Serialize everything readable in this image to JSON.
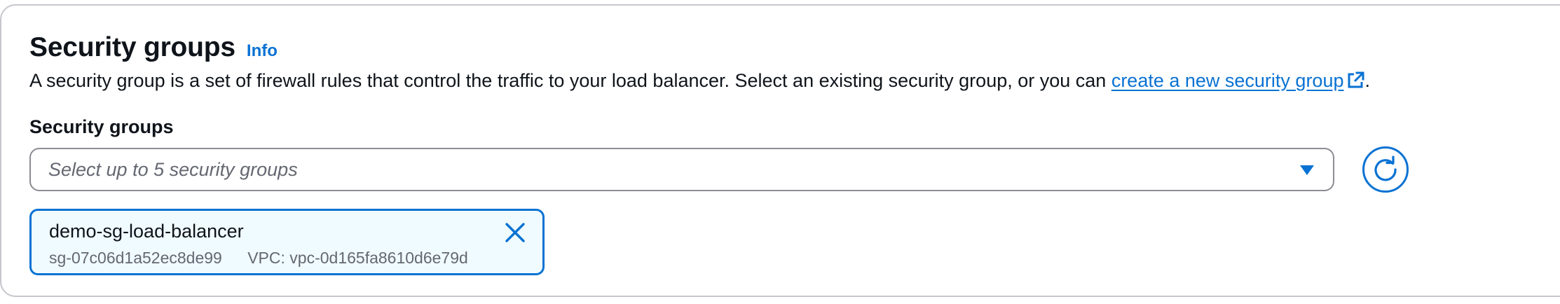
{
  "section": {
    "title": "Security groups",
    "info_label": "Info",
    "description_prefix": "A security group is a set of firewall rules that control the traffic to your load balancer. Select an existing security group, or you can ",
    "description_link": "create a new security group",
    "description_suffix": "."
  },
  "field": {
    "label": "Security groups",
    "placeholder": "Select up to 5 security groups"
  },
  "selected_groups": [
    {
      "name": "demo-sg-load-balancer",
      "id": "sg-07c06d1a52ec8de99",
      "vpc": "VPC: vpc-0d165fa8610d6e79d"
    }
  ],
  "icons": {
    "external_link": "external-link-icon",
    "dropdown": "caret-down-icon",
    "refresh": "refresh-icon",
    "remove": "close-icon"
  },
  "colors": {
    "link": "#0972d3",
    "token_background": "#f0fbff",
    "text": "#0f141a",
    "secondary_text": "#656871"
  }
}
